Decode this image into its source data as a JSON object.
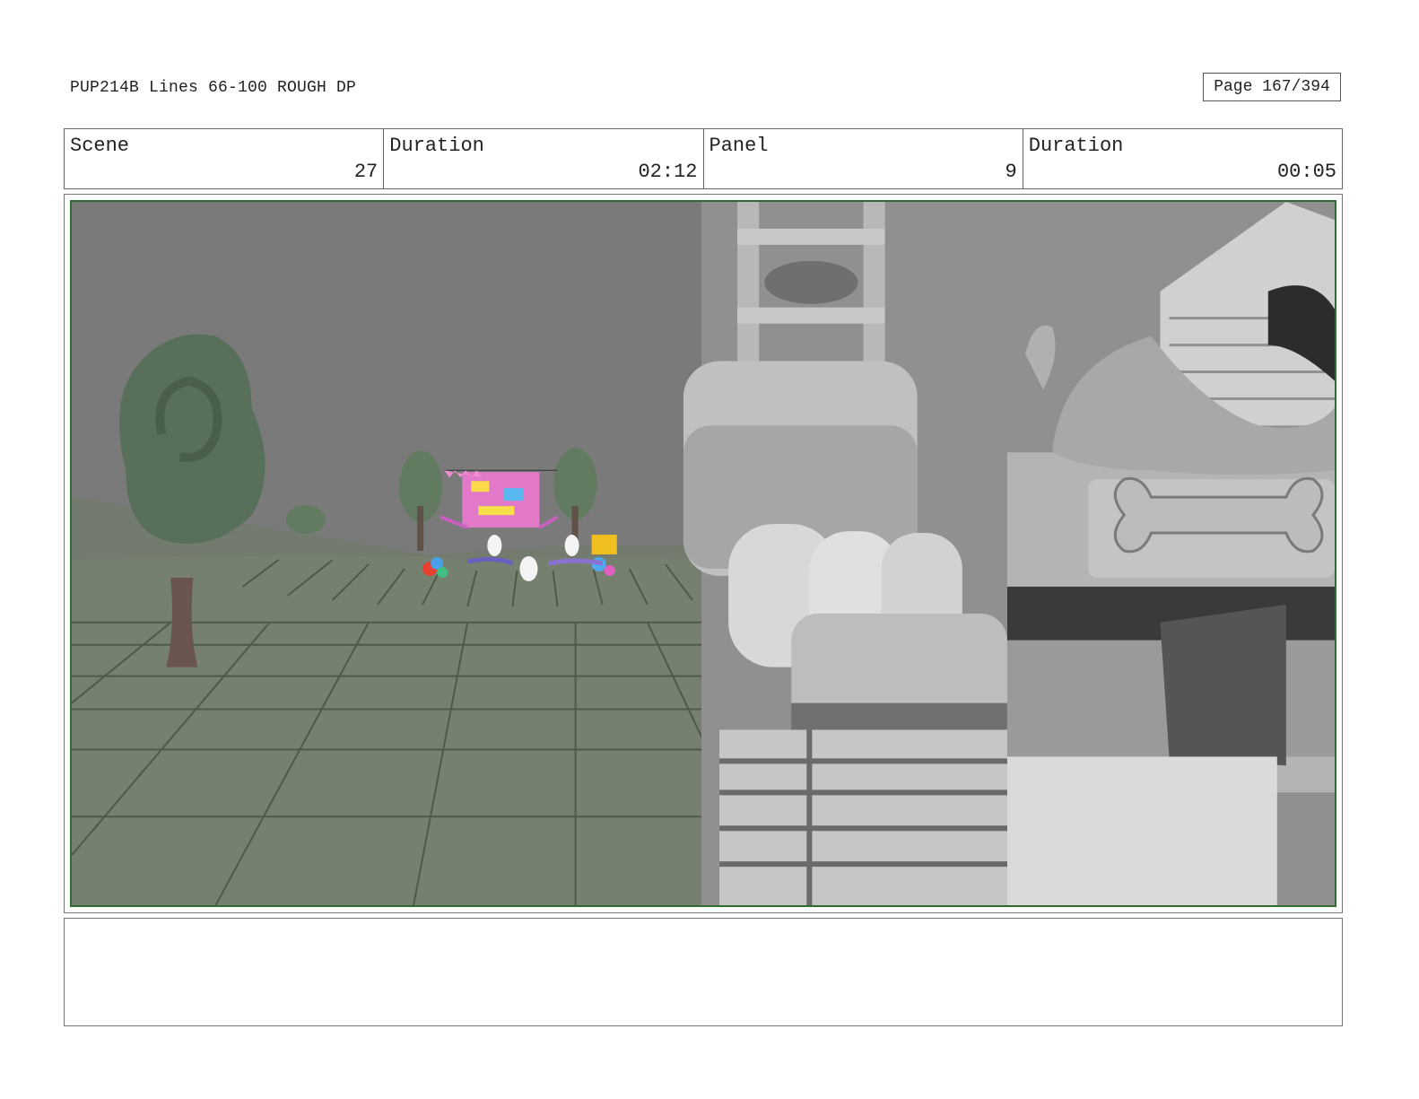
{
  "header": {
    "title": "PUP214B Lines 66-100 ROUGH DP",
    "page_label": "Page 167/394"
  },
  "info": {
    "scene_label": "Scene",
    "scene_value": "27",
    "scene_duration_label": "Duration",
    "scene_duration_value": "02:12",
    "panel_label": "Panel",
    "panel_value": "9",
    "panel_duration_label": "Duration",
    "panel_duration_value": "00:05"
  },
  "notes": {
    "text": ""
  },
  "colors": {
    "frame_border": "#2e6b2e",
    "sky": "#7b7b7b",
    "ground": "#76806f"
  }
}
